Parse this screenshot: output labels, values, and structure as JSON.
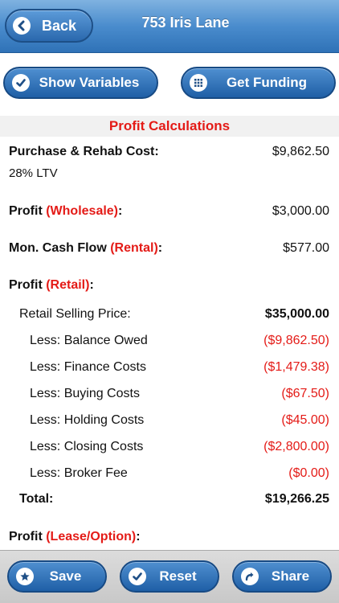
{
  "header": {
    "back_label": "Back",
    "title": "753 Iris Lane"
  },
  "actions": {
    "show_variables": "Show Variables",
    "get_funding": "Get Funding"
  },
  "section": {
    "title": "Profit Calculations"
  },
  "purchase": {
    "label": "Purchase & Rehab Cost:",
    "value": "$9,862.50",
    "ltv": "28% LTV"
  },
  "wholesale": {
    "label_prefix": "Profit ",
    "label_tag": "(Wholesale)",
    "label_suffix": ":",
    "value": "$3,000.00"
  },
  "rental": {
    "label_prefix": "Mon. Cash Flow ",
    "label_tag": "(Rental)",
    "label_suffix": ":",
    "value": "$577.00"
  },
  "retail": {
    "label_prefix": "Profit ",
    "label_tag": "(Retail)",
    "label_suffix": ":",
    "selling_price_label": "Retail Selling Price:",
    "selling_price_value": "$35,000.00",
    "deductions": [
      {
        "label": "Less: Balance Owed",
        "value": "($9,862.50)"
      },
      {
        "label": "Less: Finance Costs",
        "value": "($1,479.38)"
      },
      {
        "label": "Less: Buying Costs",
        "value": "($67.50)"
      },
      {
        "label": "Less: Holding Costs",
        "value": "($45.00)"
      },
      {
        "label": "Less: Closing Costs",
        "value": "($2,800.00)"
      },
      {
        "label": "Less: Broker Fee",
        "value": "($0.00)"
      }
    ],
    "total_label": "Total:",
    "total_value": "$19,266.25"
  },
  "lease": {
    "label_prefix": "Profit ",
    "label_tag": "(Lease/Option)",
    "label_suffix": ":"
  },
  "toolbar": {
    "save": "Save",
    "reset": "Reset",
    "share": "Share"
  },
  "colors": {
    "accent_red": "#e41b17",
    "header_blue": "#4a8ccd",
    "button_blue": "#1f5fa6"
  }
}
